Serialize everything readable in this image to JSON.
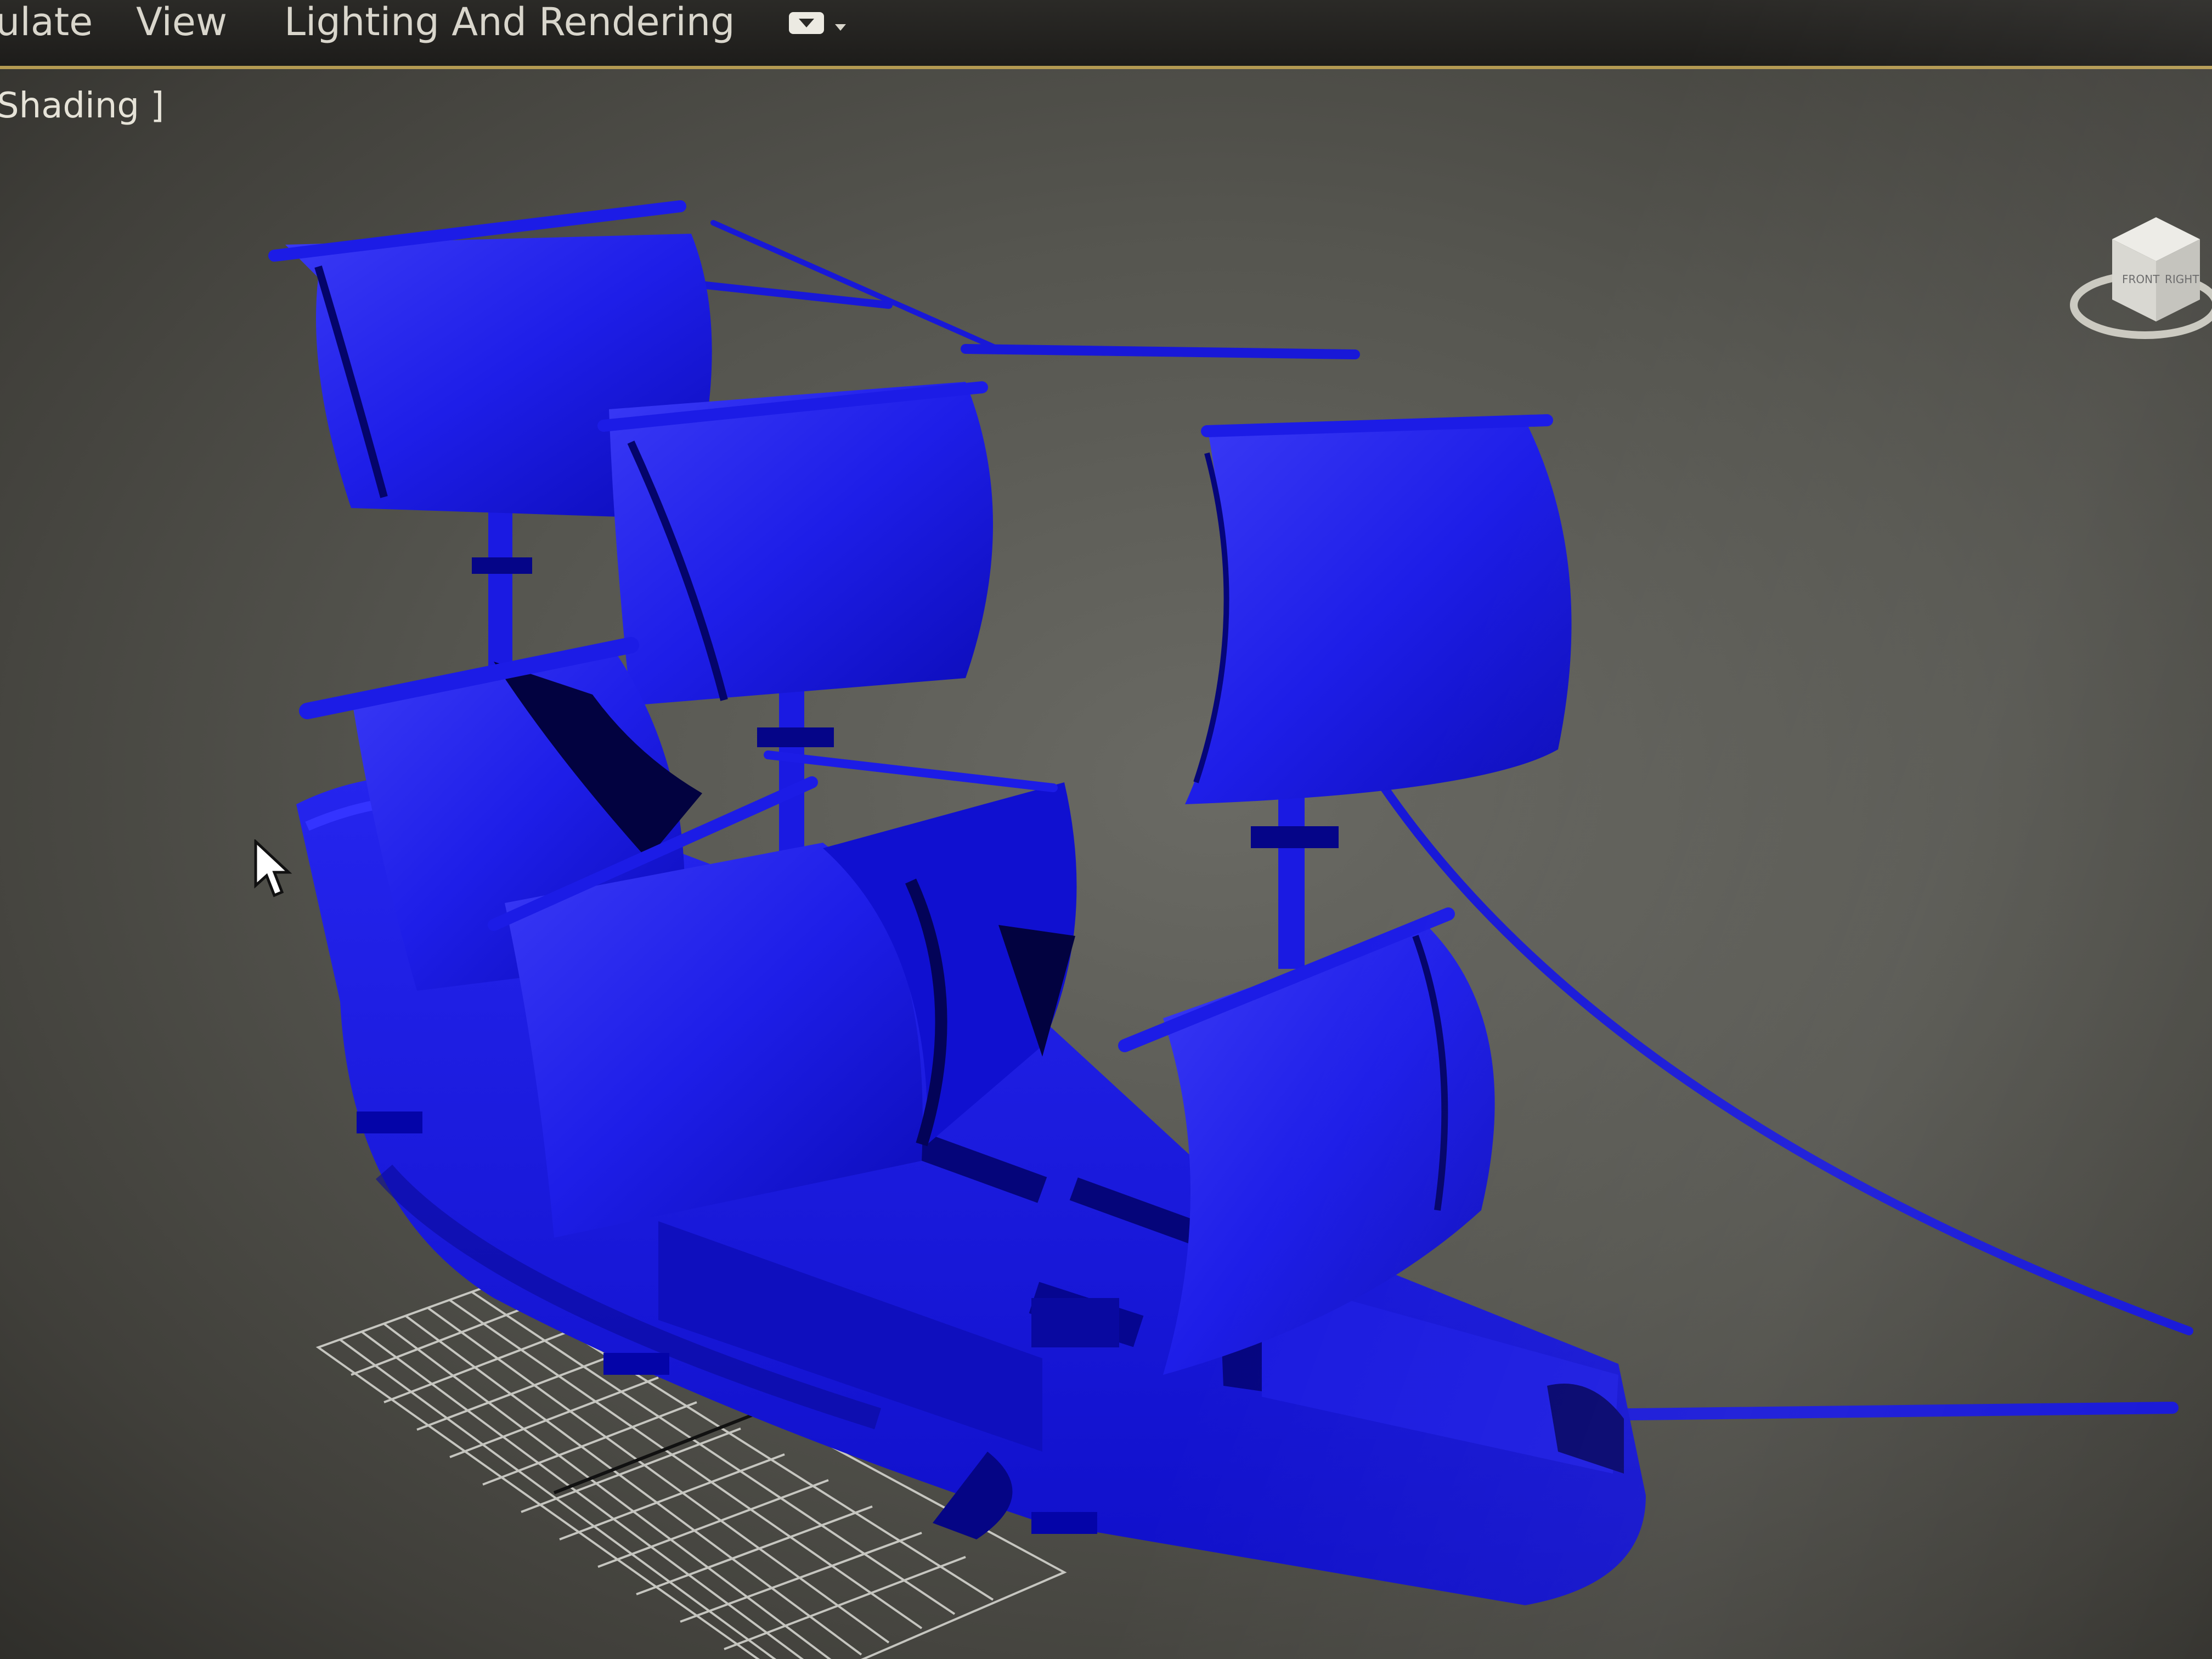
{
  "menubar": {
    "items": [
      {
        "label": "ulate"
      },
      {
        "label": "View"
      },
      {
        "label": "Lighting And Rendering"
      }
    ]
  },
  "viewport": {
    "label": "Shading ]",
    "model_color": "#1a1ae6",
    "background_color": "#5a5a55"
  },
  "viewcube": {
    "faces": [
      "FRONT",
      "RIGHT"
    ]
  },
  "icons": {
    "dropdown": "dropdown-icon",
    "cursor": "arrow-cursor-icon",
    "navigation": "viewcube-icon"
  },
  "colors": {
    "accent_border": "#b49a52",
    "menu_text": "#d9d6cc"
  }
}
